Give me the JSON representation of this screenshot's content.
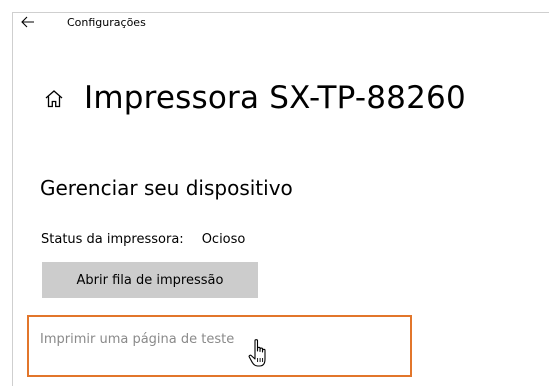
{
  "window": {
    "app_title": "Configurações",
    "back_icon": "back-arrow-icon"
  },
  "header": {
    "home_icon": "home-icon",
    "title": "Impressora SX-TP-88260"
  },
  "section": {
    "title": "Gerenciar seu dispositivo"
  },
  "status": {
    "label": "Status da impressora:",
    "value": "Ocioso"
  },
  "actions": {
    "open_queue_label": "Abrir fila de impressão",
    "print_test_label": "Imprimir uma página de teste"
  },
  "colors": {
    "highlight_border": "#e2762b",
    "button_bg": "#cccccc",
    "disabled_link_text": "#8a8a8a"
  },
  "cursor": {
    "type": "hand-pointer-icon"
  }
}
